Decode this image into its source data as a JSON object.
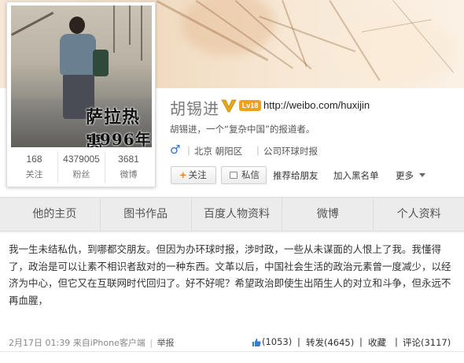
{
  "profile": {
    "name": "胡锡进",
    "level": "Lv18",
    "url": "http://weibo.com/huxijin",
    "bio": "胡锡进，一个“复杂中国”的报道者。",
    "gender_symbol": "♂",
    "location": "北京 朝阳区",
    "company": "公司环球时报",
    "avatar_caption_1": "萨拉热窝",
    "avatar_caption_2": "1996年",
    "stats": [
      {
        "value": "168",
        "label": "关注"
      },
      {
        "value": "4379005",
        "label": "粉丝"
      },
      {
        "value": "3681",
        "label": "微博"
      }
    ]
  },
  "actions": {
    "follow": "关注",
    "follow_plus": "+",
    "message": "私信",
    "recommend": "推荐给朋友",
    "blacklist": "加入黑名单",
    "more": "更多"
  },
  "tabs": [
    "他的主页",
    "图书作品",
    "百度人物资料",
    "微博",
    "个人资料"
  ],
  "post": {
    "text": "我一生未结私仇，到哪都交朋友。但因为办环球时报，涉时政，一些从未谋面的人恨上了我。我懂得了，政治是可以让素不相识者敌对的一种东西。文革以后，中国社会生活的政治元素曾一度减少，以经济为中心，但它又在互联网时代回归了。好不好呢？希望政治即使生出陌生人的对立和斗争，但永远不再血腥，",
    "timestamp": "2月17日 01:39",
    "source": "来自iPhone客户端",
    "report": "举报",
    "likes": "(1053)",
    "repost": "转发(4645)",
    "favorite": "收藏",
    "comment": "评论(3117)",
    "separator": "|"
  },
  "colors": {
    "link_blue": "#2d73c4",
    "badge_orange": "#f0a020",
    "verified_gold": "#e6a817"
  }
}
